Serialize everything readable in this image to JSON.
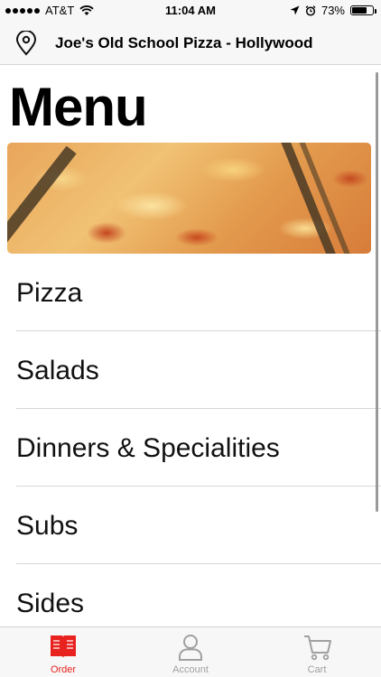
{
  "status_bar": {
    "carrier": "AT&T",
    "time": "11:04 AM",
    "battery": "73%",
    "battery_level": 0.73,
    "icons": [
      "signal-dots-icon",
      "wifi-icon",
      "location-arrow-icon",
      "alarm-icon",
      "battery-icon"
    ]
  },
  "header": {
    "title": "Joe's Old School Pizza - Hollywood",
    "icon": "location-pin-icon"
  },
  "main": {
    "title": "Menu",
    "categories": [
      {
        "label": "Pizza"
      },
      {
        "label": "Salads"
      },
      {
        "label": "Dinners & Specialities"
      },
      {
        "label": "Subs"
      },
      {
        "label": "Sides"
      }
    ]
  },
  "tabbar": {
    "tabs": [
      {
        "label": "Order",
        "icon": "menu-book-icon",
        "active": true
      },
      {
        "label": "Account",
        "icon": "person-icon",
        "active": false
      },
      {
        "label": "Cart",
        "icon": "cart-icon",
        "active": false
      }
    ]
  },
  "colors": {
    "accent": "#e8231f",
    "inactive": "#a0a0a0",
    "bar_background": "#f7f7f7"
  }
}
